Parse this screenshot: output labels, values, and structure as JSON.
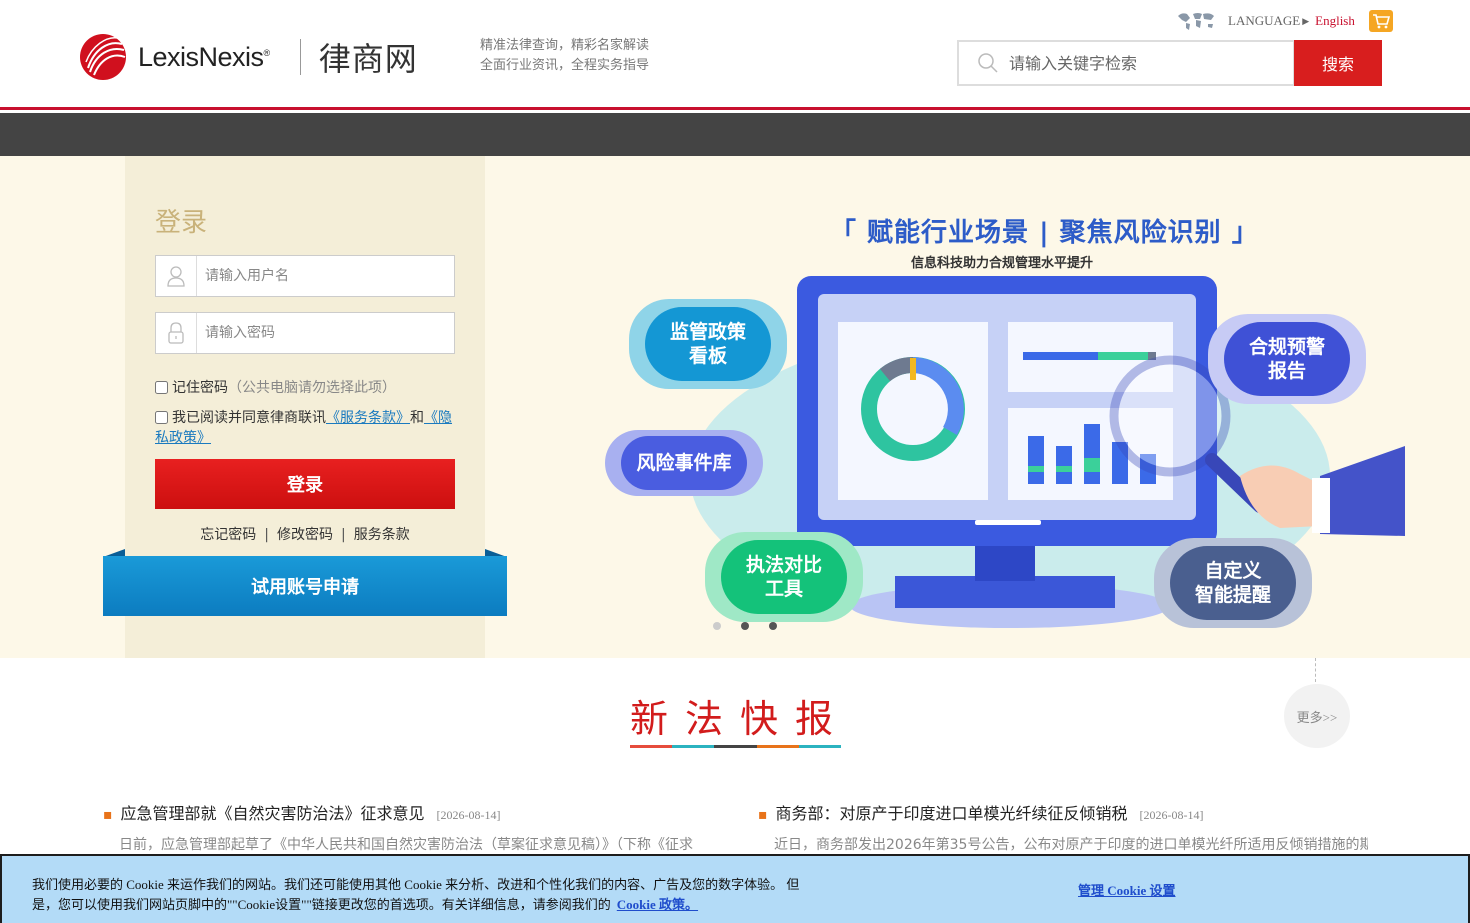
{
  "header": {
    "brand": "LexisNexis",
    "brand_mark": "®",
    "site_name": "律商网",
    "slogan_line1": "精准法律查询，精彩名家解读",
    "slogan_line2": "全面行业资讯，全程实务指导",
    "language_label": "LANGUAGE",
    "language_current": "English",
    "search_placeholder": "请输入关键字检索",
    "search_button": "搜索"
  },
  "login": {
    "title": "登录",
    "username_placeholder": "请输入用户名",
    "password_placeholder": "请输入密码",
    "remember_label": "记住密码",
    "remember_hint": "（公共电脑请勿选择此项）",
    "agree_prefix": "我已阅读并同意律商联讯",
    "terms_link": "《服务条款》",
    "agree_and": "和",
    "privacy_link": "《隐私政策》",
    "login_button": "登录",
    "forgot_password": "忘记密码",
    "change_password": "修改密码",
    "service_terms": "服务条款",
    "trial_button": "试用账号申请"
  },
  "banner": {
    "title": "「 赋能行业场景 | 聚焦风险识别 」",
    "subtitle": "信息科技助力合规管理水平提升",
    "features": [
      {
        "label": "监管政策\n看板",
        "color": "#1497d4"
      },
      {
        "label": "风险事件库",
        "color": "#4a5de0"
      },
      {
        "label": "执法对比\n工具",
        "color": "#14c27a"
      },
      {
        "label": "合规预警\n报告",
        "color": "#3f51d6"
      },
      {
        "label": "自定义\n智能提醒",
        "color": "#4a5f8f"
      }
    ],
    "slides": 3,
    "active_slide": 0
  },
  "news": {
    "title": "新法快报",
    "more": "更多>>",
    "underline_colors": [
      "#e64c3c",
      "#2bb3c0",
      "#444444",
      "#e8731a",
      "#2bb3c0"
    ],
    "items": [
      {
        "title": "应急管理部就《自然灾害防治法》征求意见",
        "date": "[2026-08-14]",
        "summary": "日前，应急管理部起草了《中华人民共和国自然灾害防治法（草案征求意见稿）》（下称《征求"
      },
      {
        "title": "商务部：对原产于印度进口单模光纤续征反倾销税",
        "date": "[2026-08-14]",
        "summary": "近日，商务部发出2026年第35号公告，公布对原产于印度的进口单模光纤所适用反倾销措施的期"
      }
    ]
  },
  "cookie": {
    "text": "我们使用必要的 Cookie 来运作我们的网站。我们还可能使用其他 Cookie 来分析、改进和个性化我们的内容、广告及您的数字体验。 但是，您可以使用我们网站页脚中的\"\"Cookie设置\"\"链接更改您的首选项。有关详细信息，请参阅我们的",
    "policy_link": "Cookie 政策。",
    "manage": "管理 Cookie 设置"
  },
  "colors": {
    "brand_red": "#c8102e",
    "accent_blue": "#0c7cc0"
  }
}
